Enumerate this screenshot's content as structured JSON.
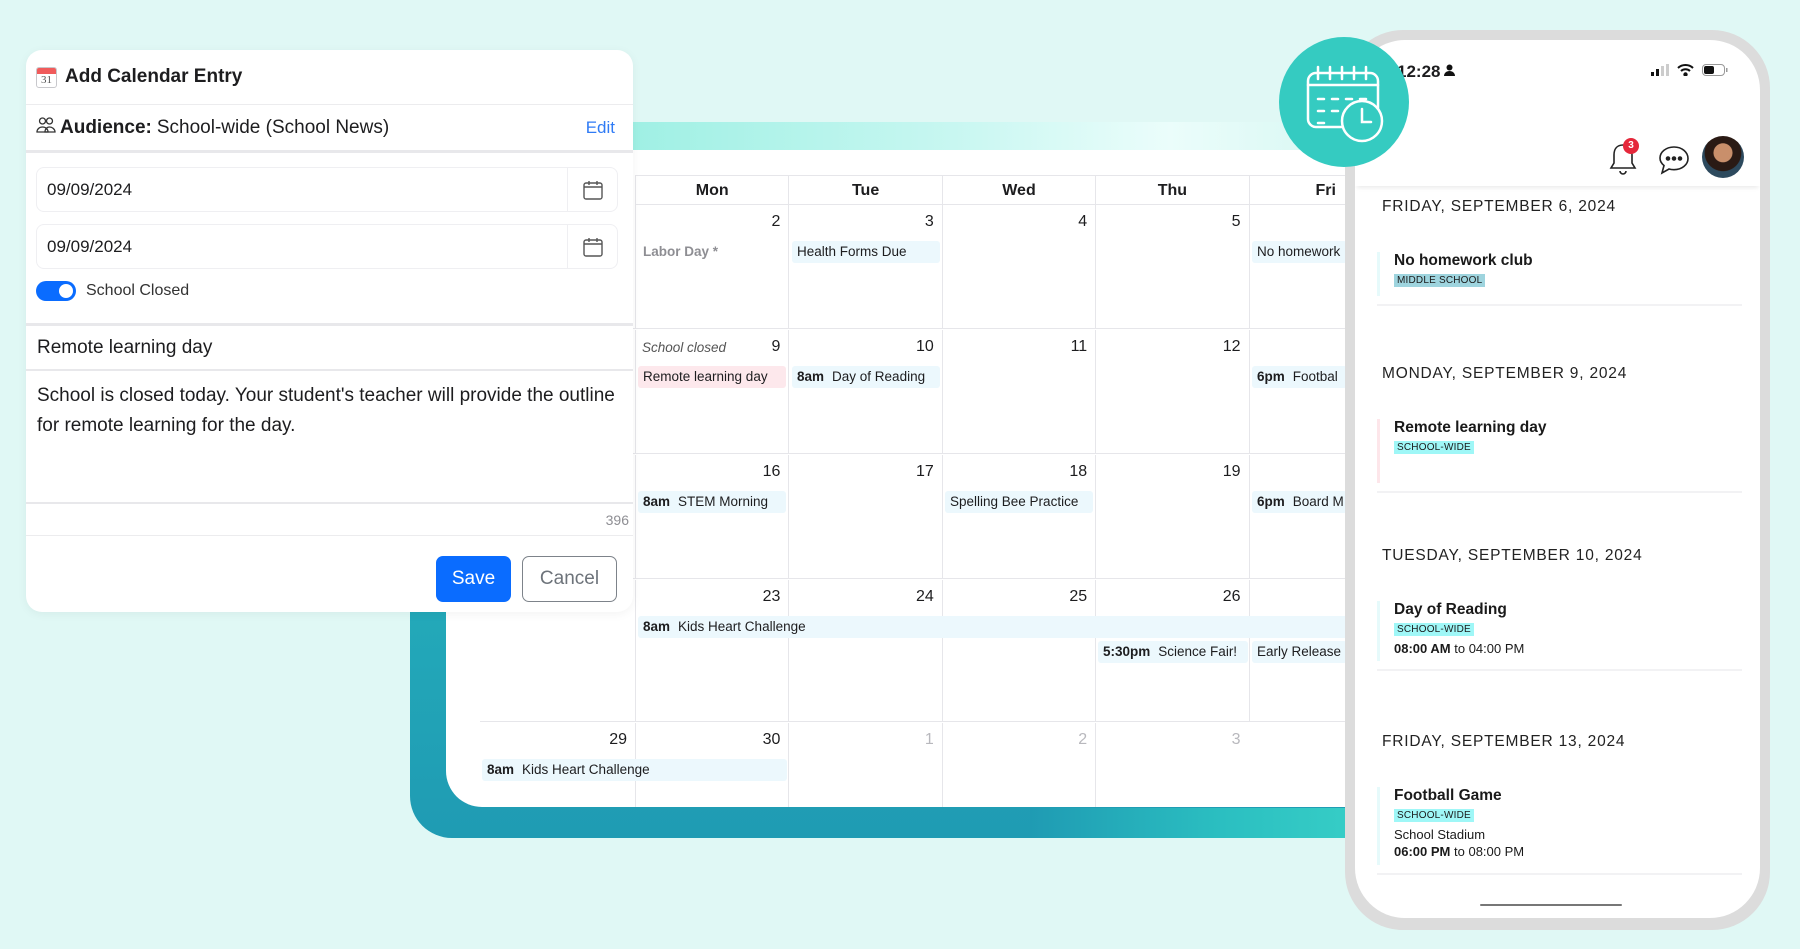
{
  "form": {
    "title": "Add Calendar Entry",
    "title_icon_text": "31",
    "audience_label": "Audience:",
    "audience_value": "School-wide (School News)",
    "edit_label": "Edit",
    "start_date": "09/09/2024",
    "end_date": "09/09/2024",
    "school_closed_label": "School Closed",
    "school_closed": true,
    "subject": "Remote learning day",
    "body": "School is closed today. Your student's teacher will provide the outline for remote learning for the day.",
    "char_count": "396",
    "save_label": "Save",
    "cancel_label": "Cancel"
  },
  "calendar": {
    "day_headers": [
      "Mon",
      "Tue",
      "Wed",
      "Thu",
      "Fri"
    ],
    "weeks": [
      {
        "days": [
          {
            "num": "2"
          },
          {
            "num": "3"
          },
          {
            "num": "4"
          },
          {
            "num": "5"
          },
          {
            "num": ""
          }
        ],
        "events": [
          {
            "text": "Labor Day *",
            "time": "",
            "style": "plain"
          },
          {
            "text": "Health Forms Due",
            "time": "",
            "style": "blue"
          },
          {
            "text": "No homework",
            "time": "",
            "style": "blue"
          }
        ]
      },
      {
        "days": [
          {
            "num": "9",
            "note": "School closed"
          },
          {
            "num": "10"
          },
          {
            "num": "11"
          },
          {
            "num": "12"
          },
          {
            "num": ""
          }
        ],
        "events": [
          {
            "text": "Remote learning day",
            "time": "",
            "style": "pink"
          },
          {
            "text": "Day of Reading",
            "time": "8am",
            "style": "blue"
          },
          {
            "text": "Footbal",
            "time": "6pm",
            "style": "blue"
          }
        ]
      },
      {
        "days": [
          {
            "num": "16"
          },
          {
            "num": "17"
          },
          {
            "num": "18"
          },
          {
            "num": "19"
          },
          {
            "num": ""
          }
        ],
        "events": [
          {
            "text": "STEM Morning",
            "time": "8am",
            "style": "blue"
          },
          {
            "text": "Spelling Bee Practice",
            "time": "",
            "style": "blue"
          },
          {
            "text": "Board M",
            "time": "6pm",
            "style": "blue"
          }
        ]
      },
      {
        "days": [
          {
            "num": "23"
          },
          {
            "num": "24"
          },
          {
            "num": "25"
          },
          {
            "num": "26"
          },
          {
            "num": ""
          }
        ],
        "events": [
          {
            "text": "Kids Heart Challenge",
            "time": "8am",
            "style": "blue"
          },
          {
            "text": "Science Fair!",
            "time": "5:30pm",
            "style": "blue"
          },
          {
            "text": "Early Release a",
            "time": "",
            "style": "blue"
          }
        ]
      },
      {
        "days": [
          {
            "num": "29"
          },
          {
            "num": "30"
          },
          {
            "num": "1",
            "muted": true
          },
          {
            "num": "2",
            "muted": true
          },
          {
            "num": "3",
            "muted": true
          }
        ],
        "events": [
          {
            "text": "Kids Heart Challenge",
            "time": "8am",
            "style": "blue"
          }
        ]
      }
    ]
  },
  "phone": {
    "status_time": "12:28",
    "notification_count": "3",
    "feed": [
      {
        "date": "FRIDAY, SEPTEMBER 6, 2024",
        "title": "No homework club",
        "tag": "MIDDLE SCHOOL"
      },
      {
        "date": "MONDAY, SEPTEMBER 9, 2024",
        "title": "Remote learning day",
        "tag": "SCHOOL-WIDE"
      },
      {
        "date": "TUESDAY, SEPTEMBER 10, 2024",
        "title": "Day of Reading",
        "tag": "SCHOOL-WIDE",
        "time_start": "08:00 AM",
        "time_sep": "to",
        "time_end": "04:00 PM"
      },
      {
        "date": "FRIDAY, SEPTEMBER 13, 2024",
        "title": "Football Game",
        "tag": "SCHOOL-WIDE",
        "location": "School Stadium",
        "time_start": "06:00 PM",
        "time_sep": "to",
        "time_end": "08:00 PM"
      }
    ]
  },
  "colors": {
    "background": "#e0f8f5",
    "accent_teal": "#35cbc1",
    "primary_blue": "#0a6cff",
    "link_blue": "#2f7bf5",
    "event_blue_bg": "#ecf8fd",
    "event_pink_bg": "#fde8ec",
    "badge_red": "#e5283b"
  }
}
